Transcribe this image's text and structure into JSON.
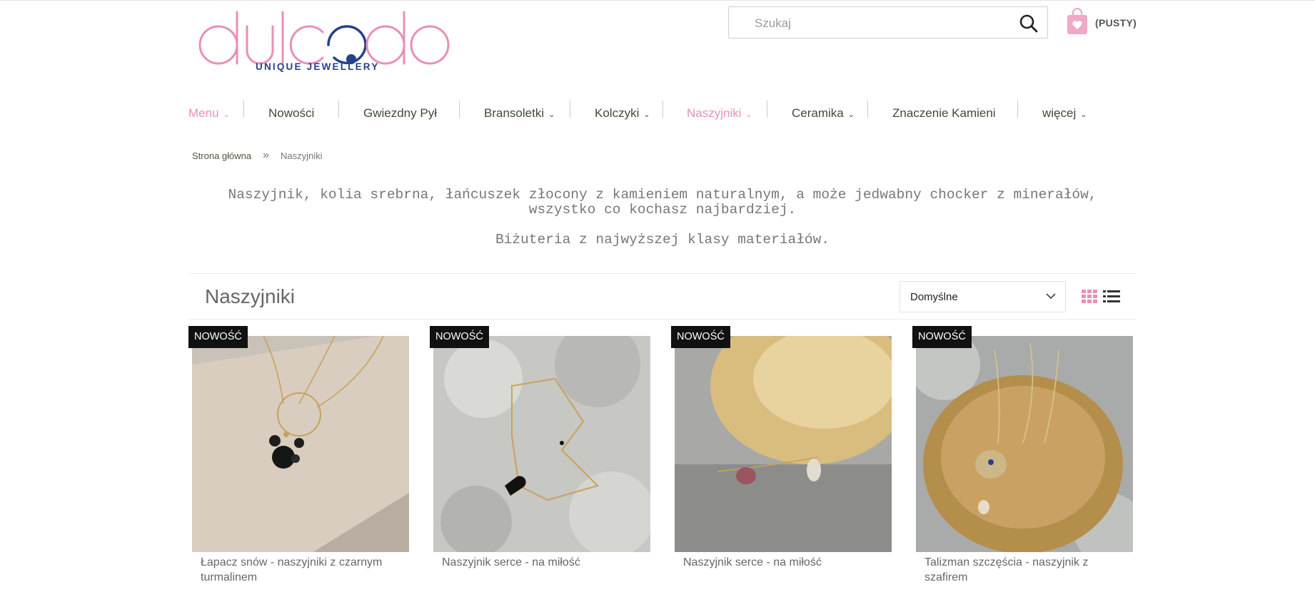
{
  "brand": {
    "logo_text": "dulcedo",
    "tagline": "UNIQUE JEWELLERY",
    "colors": {
      "pink": "#e88fb8",
      "navy": "#27408b",
      "nav_green": "#3d4b32"
    }
  },
  "search": {
    "placeholder": "Szukaj",
    "icon": "search-icon"
  },
  "cart": {
    "label": "(PUSTY)",
    "icon": "shopping-bag-heart-icon"
  },
  "nav": {
    "menu": "Menu",
    "nowosci": "Nowości",
    "gwiezdny": "Gwiezdny Pył",
    "bransoletki": "Bransoletki",
    "kolczyki": "Kolczyki",
    "naszyjniki": "Naszyjniki",
    "ceramika": "Ceramika",
    "znaczenie": "Znaczenie Kamieni",
    "wiecej": "więcej"
  },
  "breadcrumb": {
    "home": "Strona główna",
    "separator": "»",
    "current": "Naszyjniki"
  },
  "description": {
    "line1": "Naszyjnik, kolia srebrna, łańcuszek złocony z kamieniem naturalnym, a może jedwabny chocker z minerałów,",
    "line2": "wszystko co kochasz najbardziej.",
    "line3": "Biżuteria z najwyższej klasy materiałów."
  },
  "category": {
    "title": "Naszyjniki"
  },
  "sort": {
    "selected": "Domyślne"
  },
  "view": {
    "grid_icon": "grid-view-icon",
    "list_icon": "list-view-icon"
  },
  "products": [
    {
      "badge": "NOWOŚĆ",
      "name": "Łapacz snów - naszyjniki z czarnym turmalinem"
    },
    {
      "badge": "NOWOŚĆ",
      "name": "Naszyjnik serce - na miłość"
    },
    {
      "badge": "NOWOŚĆ",
      "name": "Naszyjnik serce - na miłość"
    },
    {
      "badge": "NOWOŚĆ",
      "name": "Talizman szczęścia - naszyjnik z szafirem"
    }
  ]
}
